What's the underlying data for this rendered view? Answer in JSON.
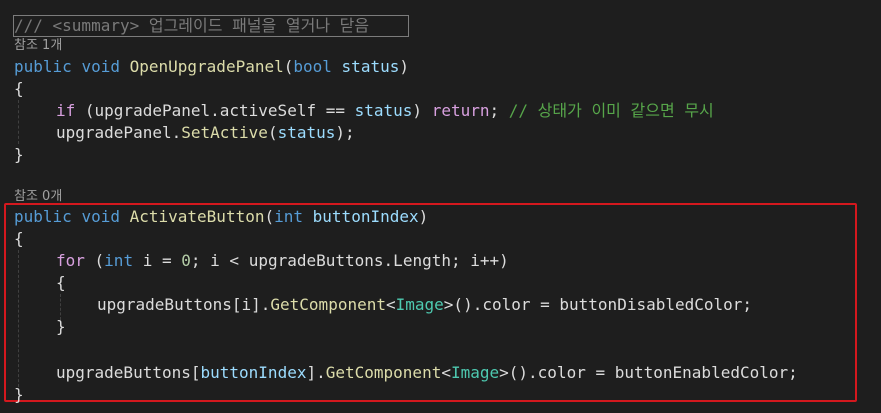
{
  "editor": {
    "summary_comment": "/// <summary> 업그레이드 패널을 열거나 닫음",
    "method1": {
      "ref_count": "참조 1개",
      "sig_public": "public",
      "sig_void": "void",
      "sig_name": "OpenUpgradePanel",
      "sig_open": "(",
      "sig_type": "bool",
      "sig_param": "status",
      "sig_close": ")",
      "open_brace": "{",
      "l1_if": "if",
      "l1_a": " (upgradePanel.activeSelf ",
      "l1_op": "==",
      "l1_param": "status",
      "l1_b": ") ",
      "l1_return": "return",
      "l1_semi": ";",
      "l1_comment": "// 상태가 이미 같으면 무시",
      "l2_a": "upgradePanel.",
      "l2_method": "SetActive",
      "l2_b": "(",
      "l2_param": "status",
      "l2_c": ");",
      "close_brace": "}"
    },
    "method2": {
      "ref_count": "참조 0개",
      "sig_public": "public",
      "sig_void": "void",
      "sig_name": "ActivateButton",
      "sig_open": "(",
      "sig_type": "int",
      "sig_param": "buttonIndex",
      "sig_close": ")",
      "open_brace": "{",
      "for_kw": "for",
      "for_a": " (",
      "for_int": "int",
      "for_b": " i = ",
      "for_zero": "0",
      "for_c": "; i < upgradeButtons.Length; i++)",
      "inner_open": "{",
      "l_a": "upgradeButtons[i].",
      "l_method": "GetComponent",
      "l_lt": "<",
      "l_type": "Image",
      "l_rest": ">().color = buttonDisabledColor;",
      "inner_close": "}",
      "e_a": "upgradeButtons[",
      "e_param": "buttonIndex",
      "e_b": "].",
      "e_method": "GetComponent",
      "e_lt": "<",
      "e_type": "Image",
      "e_rest": ">().color = buttonEnabledColor;",
      "close_brace": "}"
    }
  },
  "colors": {
    "background": "#1e1e1e",
    "keyword": "#569cd6",
    "control": "#d8a0df",
    "method": "#dcdcaa",
    "type": "#4ec9b0",
    "parameter": "#9cdcfe",
    "comment": "#57a64a",
    "highlight": "#d4181e"
  }
}
